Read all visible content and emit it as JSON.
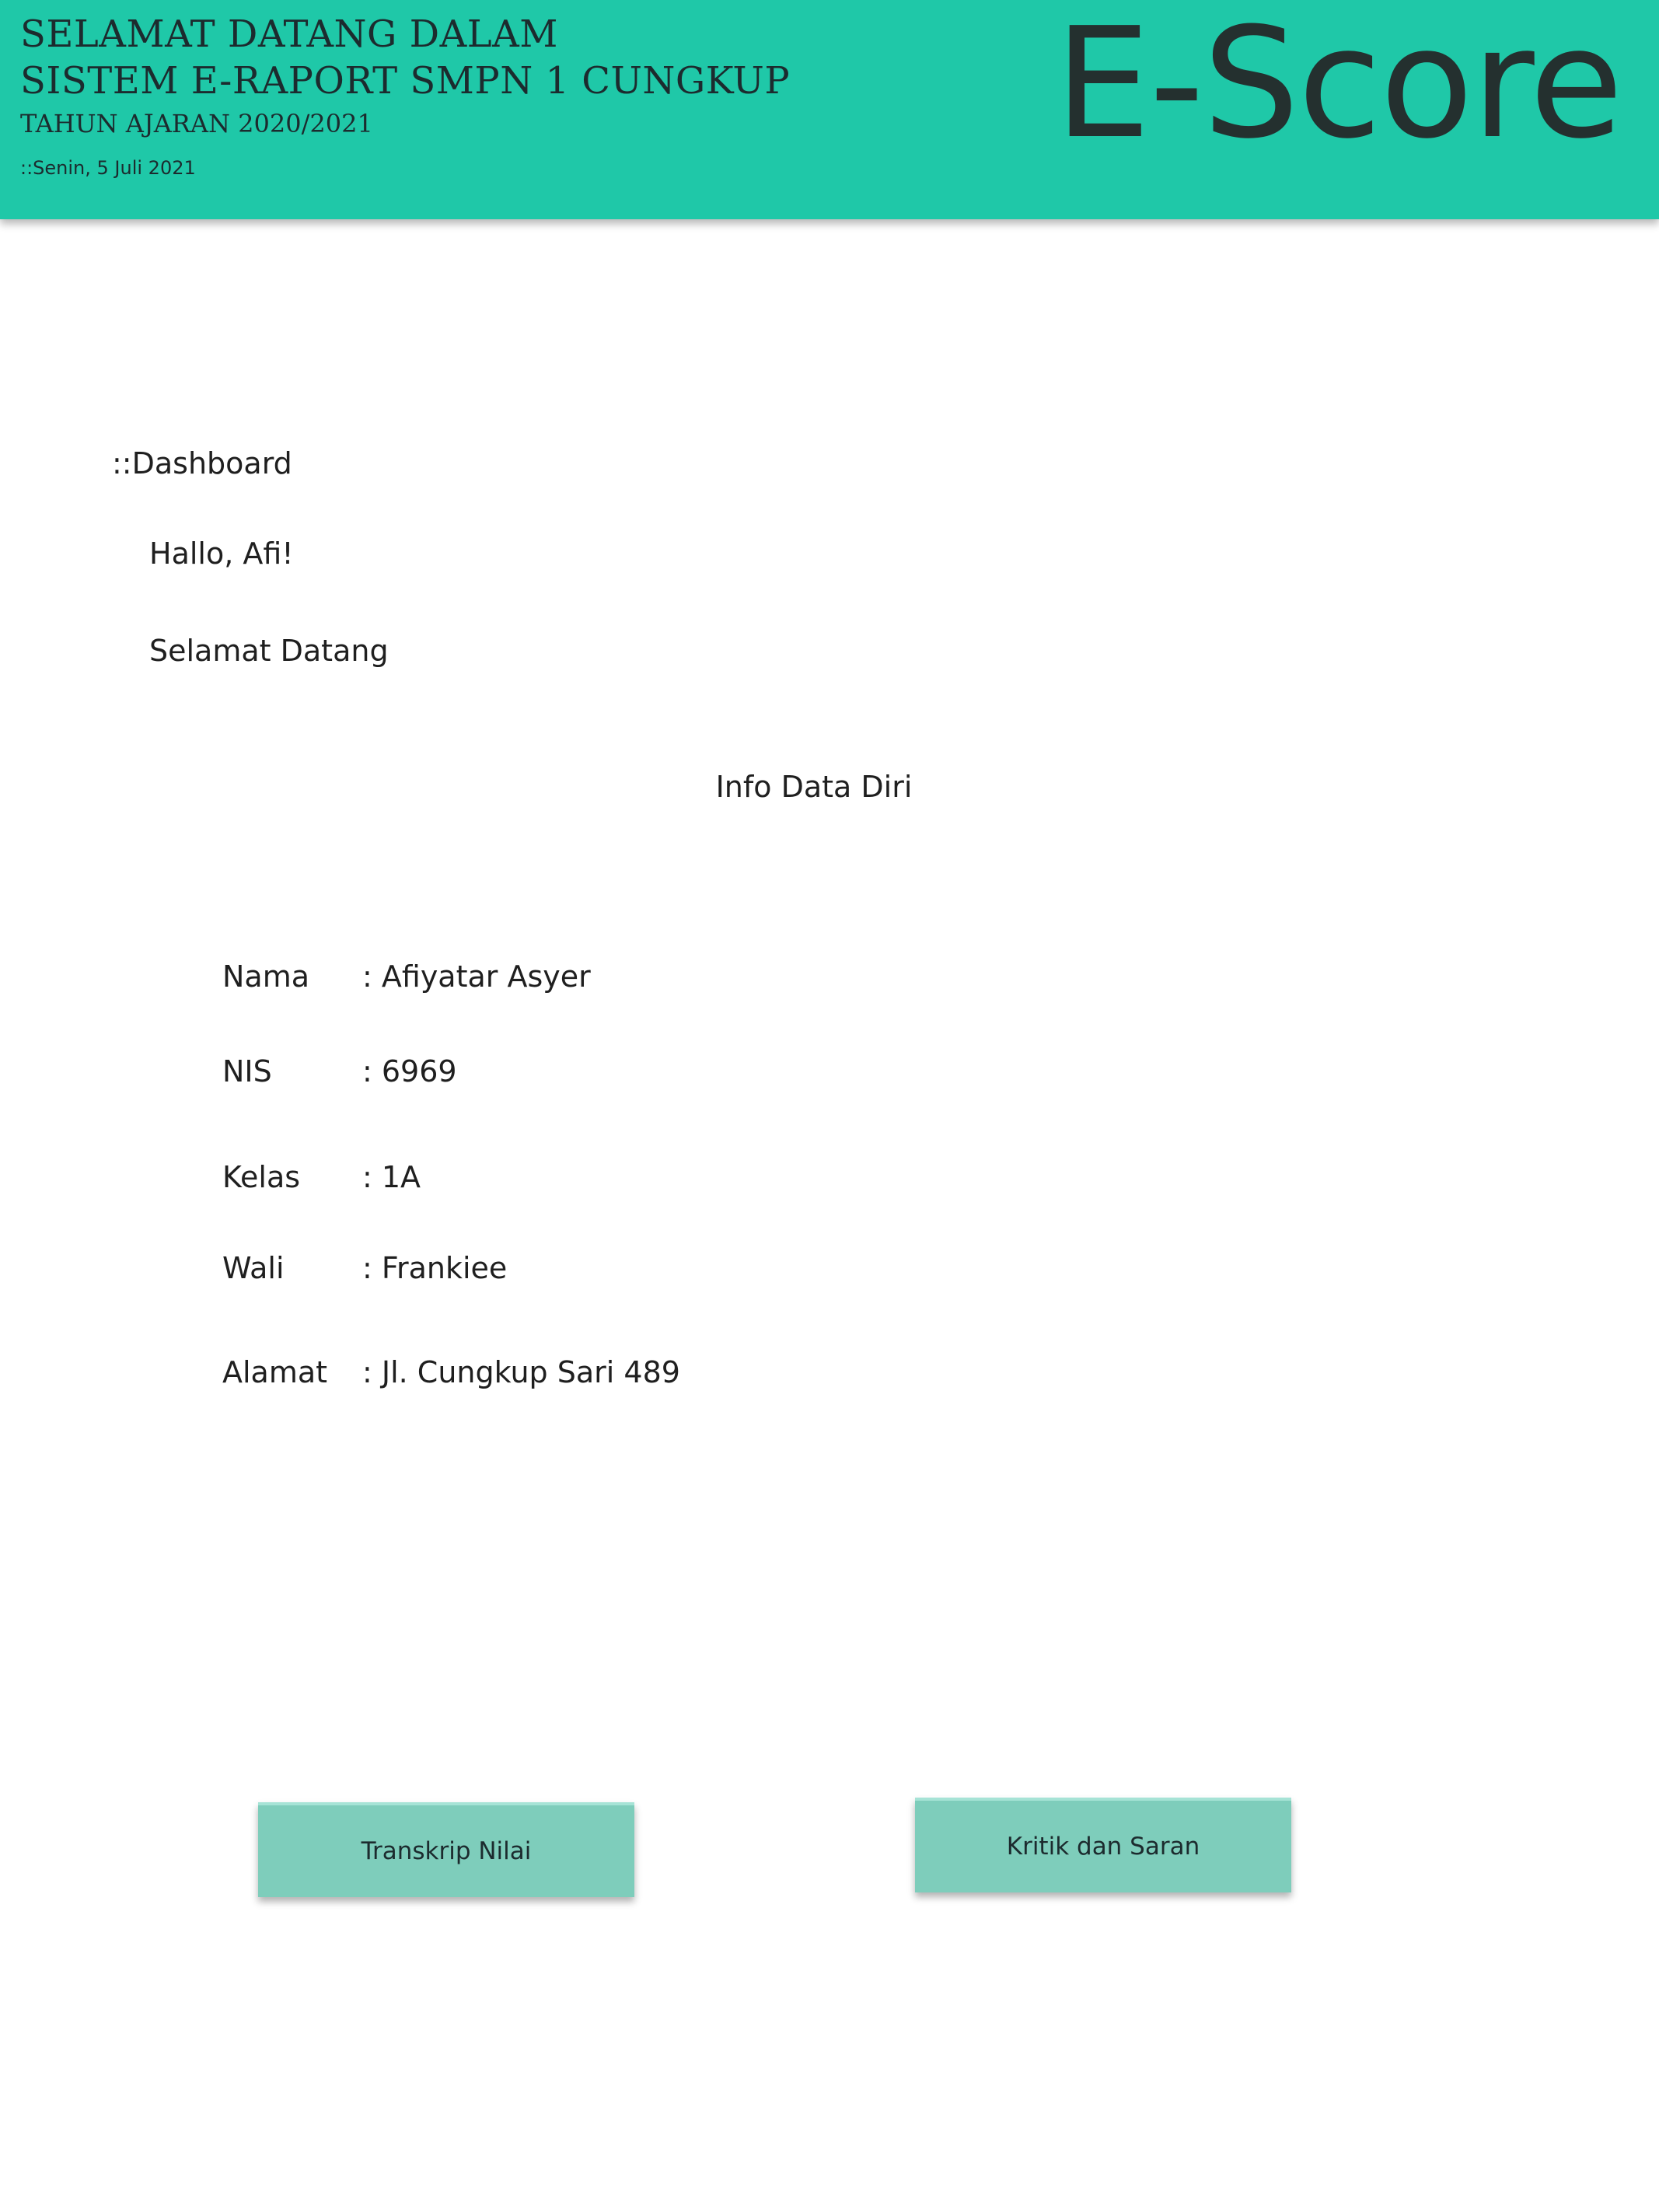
{
  "header": {
    "line1": "SELAMAT DATANG DALAM",
    "line2": "SISTEM E-RAPORT SMPN 1 CUNGKUP",
    "line3": "TAHUN AJARAN 2020/2021",
    "date": "::Senin, 5 Juli 2021",
    "logo": "E-Score",
    "accent_color": "#1fc8a8"
  },
  "main": {
    "breadcrumb": "::Dashboard",
    "greeting": "Hallo, Afi!",
    "welcome": "Selamat Datang",
    "info_title": "Info Data Diri",
    "info": [
      {
        "label": "Nama",
        "value": ": Afiyatar Asyer"
      },
      {
        "label": "NIS",
        "value": ": 6969"
      },
      {
        "label": "Kelas",
        "value": ": 1A"
      },
      {
        "label": "Wali",
        "value": ": Frankiee"
      },
      {
        "label": "Alamat",
        "value": ": Jl. Cungkup Sari 489"
      }
    ]
  },
  "actions": {
    "transcript_label": "Transkrip Nilai",
    "feedback_label": "Kritik dan Saran",
    "button_color": "#7ecdbb"
  }
}
